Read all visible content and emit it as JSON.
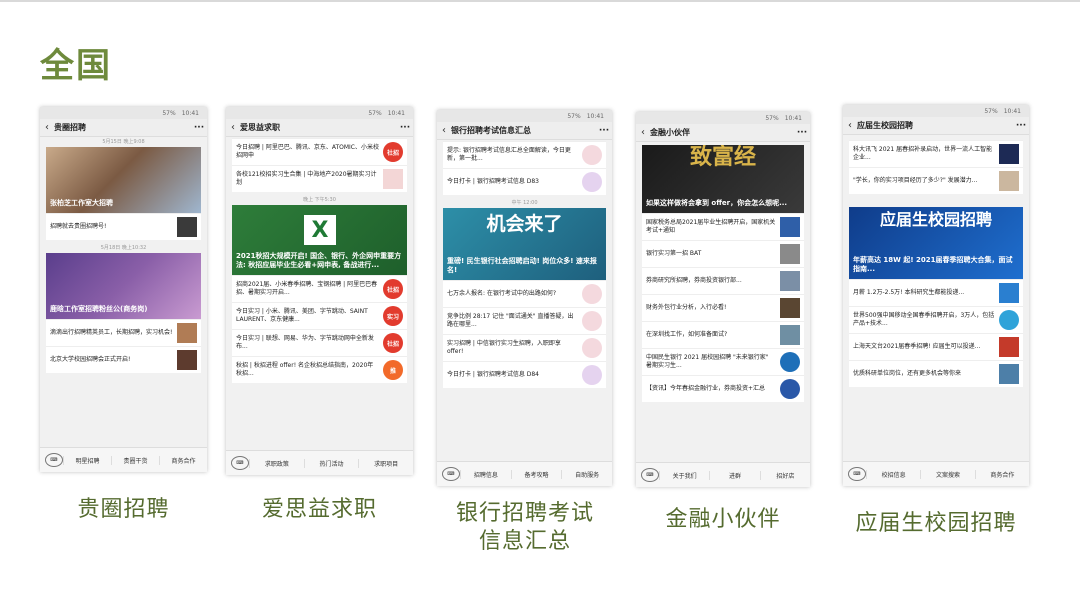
{
  "slide": {
    "title": "全国"
  },
  "status": {
    "batt": "57%",
    "time": "10:41"
  },
  "phones": [
    {
      "title": "贵圈招聘",
      "caption": "贵圈招聘",
      "ts1": "5月15日 晚上9:08",
      "cover1": "张柏芝工作室大招聘",
      "row1": "招聘就去贵圈招聘号!",
      "ts2": "5月18日 晚上10:32",
      "cover2": "鹿晗工作室招聘粉丝公(商务岗)",
      "row2": "滴滴出行招聘精英员工，长期招聘，实习机会!",
      "row3": "北京大学校园招聘会正式开启!",
      "menu": [
        "明星招聘",
        "贵圈干货",
        "商务合作"
      ]
    },
    {
      "title": "爱思益求职",
      "caption": "爱思益求职",
      "top1": "今日招聘 | 阿里巴巴、腾讯、京东、ATOMIC、小米校招网申",
      "top2": "各校121校招实习生合集 | 中海地产2020暑期实习计划",
      "ts": "晚上 下午5:30",
      "cover": "2021秋招大规模开启! 国企、银行、外企网申重要方法: 秋招应届毕业生必看+网申表, 备战进行...",
      "rows": [
        "招商2021届、小米春季招聘、宝钢招聘 | 阿里巴巴春招、暑期实习开启...",
        "今日实习 | 小米、腾讯、美团、字节跳动、SAINT LAURENT、京东健康...",
        "今日实习 | 联想、网易、华为、字节跳动网申全新发布...",
        "秋招 | 秋招进程 offer! 名企秋招总结指南，2020年秋招..."
      ],
      "logos": [
        "社招",
        "实习",
        "社招",
        "推"
      ],
      "menu": [
        "求职政策",
        "热门活动",
        "求职项目"
      ]
    },
    {
      "title": "银行招聘考试信息汇总",
      "caption": "银行招聘考试\n信息汇总",
      "top1": "提示: 银行招聘考试信息汇总全面解读，今日更新，第一批...",
      "top2": "今日打卡 | 银行招聘考试信息 D83",
      "ts": "中午 12:00",
      "cover_big": "机会来了",
      "cover": "重磅! 民生银行社会招聘启动! 岗位众多! 速来报名!",
      "rows": [
        "七万余人报名: 在银行考试中的出路如何?",
        "竞争比例 28:17 记住 \"面试通关\" 直播答疑，出路在哪里...",
        "实习招聘 | 中信银行实习生招聘，入职即享 offer!",
        "今日打卡 | 银行招聘考试信息 D84"
      ],
      "menu": [
        "招聘信息",
        "备考攻略",
        "自助服务"
      ]
    },
    {
      "title": "金融小伙伴",
      "caption": "金融小伙伴",
      "cover_big": "致富经",
      "cover": "如果这样做将会拿到 offer，你会怎么想呢...",
      "rows": [
        "国家税务总局2021届毕业生招聘开启，国家机关考试+通知",
        "银行实习第一招 BAT",
        "券商研究所招聘，券商投资银行部...",
        "财务外包行业分析，入行必看!",
        "在深圳找工作，如何准备面试?",
        "中国民生银行 2021 届校园招聘 \"未来银行家\" 暑期实习生...",
        "【资讯】今年春招金融行业，券商投资+汇总"
      ],
      "menu": [
        "关于我们",
        "进群",
        "招好店"
      ]
    },
    {
      "title": "应届生校园招聘",
      "caption": "应届生校园招聘",
      "top1": "科大讯飞 2021 届春招补录启动，世界一流人工智能企业...",
      "top2": "\"学长，你的实习项目经历了多少?\" 发展潜力...",
      "cover_big": "应届生校园招聘",
      "cover": "年薪高达 18W 起! 2021届春季招聘大合集，面试指南...",
      "rows": [
        "月薪 1.2万-2.5万! 本科研究生都能投递...",
        "世界500强中国移动全国春季招聘开启，3万人，包括产品+技术...",
        "上海天文台2021届春季招聘! 应届生可以投递...",
        "优质科研单位岗位，还有更多机会等你来"
      ],
      "menu": [
        "校招信息",
        "文案搜索",
        "商务合作"
      ]
    }
  ]
}
